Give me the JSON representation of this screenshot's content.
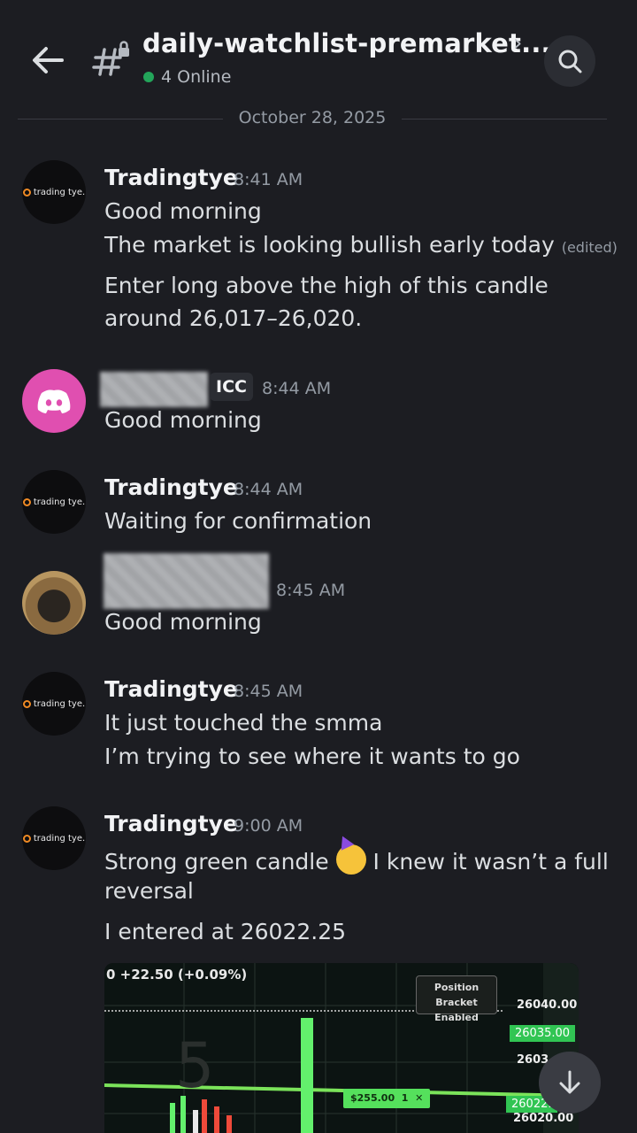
{
  "header": {
    "channel_name": "daily-watchlist-premarket...",
    "online_count": "4 Online",
    "icons": [
      "arrow-left-icon",
      "hashtag-lock-icon",
      "chevron-right-icon",
      "search-icon"
    ]
  },
  "date_divider": "October 28, 2025",
  "avatar_logo_text": "trading tye.",
  "messages": [
    {
      "username": "Tradingtye",
      "time": "8:41 AM",
      "lines": [
        "Good morning",
        "The market is looking bullish early today",
        "Enter long above the high of this candle",
        "around 26,017–26,020."
      ],
      "edited": "(edited)"
    },
    {
      "username_hidden": true,
      "role_tag": "ICC",
      "time": "8:44 AM",
      "lines": [
        "Good morning"
      ]
    },
    {
      "username": "Tradingtye",
      "time": "8:44 AM",
      "lines": [
        "Waiting for confirmation"
      ]
    },
    {
      "username_hidden": true,
      "time": "8:45 AM",
      "lines": [
        "Good morning"
      ]
    },
    {
      "username": "Tradingtye",
      "time": "8:45 AM",
      "lines": [
        "It just touched the smma",
        "I’m trying to see where it wants to go"
      ]
    },
    {
      "username": "Tradingtye",
      "time": "9:00 AM",
      "lines": [
        "Strong green candle",
        "I knew it wasn’t a full",
        "reversal",
        "I entered at 26022.25"
      ],
      "emoji": "partying-face-emoji"
    }
  ],
  "attachment": {
    "change_text": "​0 +22.50 (+0.09%)",
    "bracket_text": "Position Bracket Enabled",
    "prices": [
      "26040.00",
      "26035.00",
      "2603​",
      "26022.",
      "26020.00"
    ],
    "order_label": "$255.00",
    "order_qty": "1",
    "order_close": "✕"
  },
  "colors": {
    "background": "#1c1d22",
    "online": "#23a55a",
    "discord_avatar": "#e04fb0",
    "chart_green": "#55e05c"
  }
}
